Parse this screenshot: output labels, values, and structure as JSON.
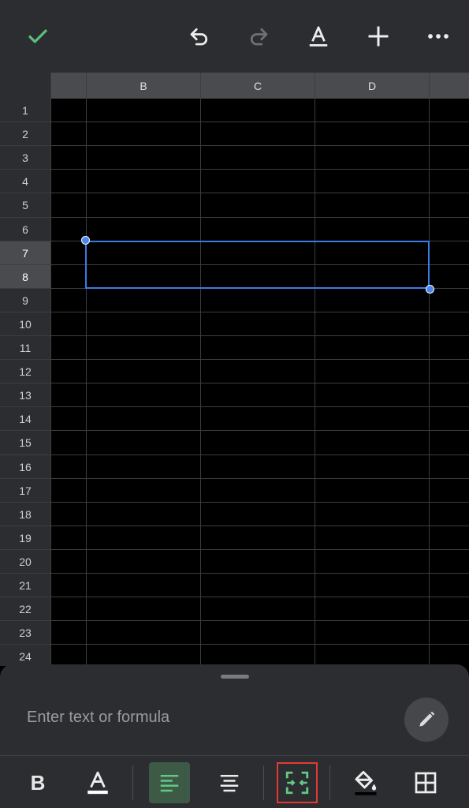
{
  "toolbar": {
    "icons": [
      "check-icon",
      "undo-icon",
      "redo-icon",
      "text-format-icon",
      "add-icon",
      "more-icon"
    ],
    "accent": "#5bbf7a"
  },
  "sheet": {
    "columns": [
      "",
      "B",
      "C",
      "D"
    ],
    "rows": [
      "1",
      "2",
      "3",
      "4",
      "5",
      "6",
      "7",
      "8",
      "9",
      "10",
      "11",
      "12",
      "13",
      "14",
      "15",
      "16",
      "17",
      "18",
      "19",
      "20",
      "21",
      "22",
      "23",
      "24"
    ],
    "selected_rows": [
      "7",
      "8"
    ],
    "selection_color": "#3b7be5"
  },
  "formula_bar": {
    "placeholder": "Enter text or formula"
  },
  "format_bar": {
    "bold_label": "B",
    "icons": [
      "bold-icon",
      "text-color-icon",
      "align-left-icon",
      "align-center-icon",
      "merge-cells-icon",
      "fill-color-icon",
      "borders-icon"
    ]
  }
}
